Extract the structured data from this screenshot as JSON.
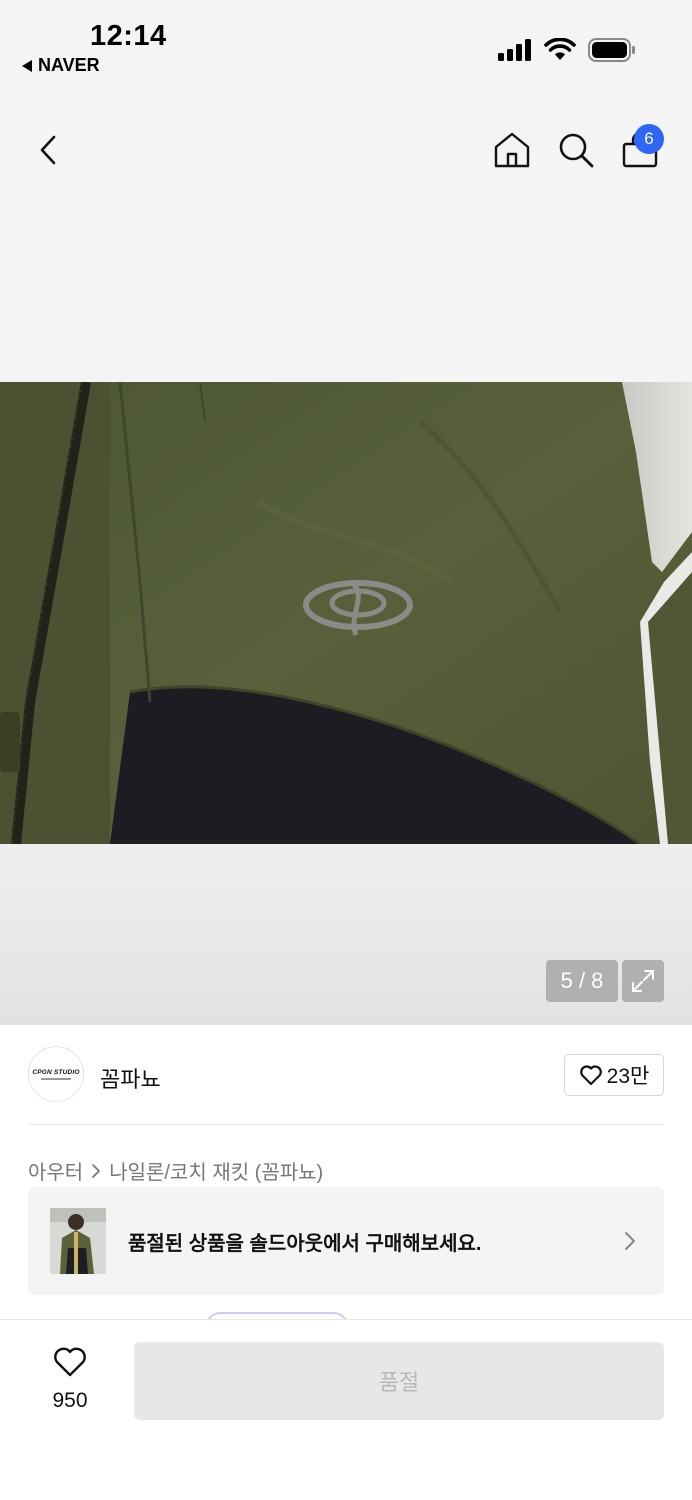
{
  "status_bar": {
    "time": "12:14",
    "back_app": "NAVER"
  },
  "nav": {
    "cart_count": "6"
  },
  "gallery": {
    "page_indicator": "5 / 8"
  },
  "seller": {
    "logo_text": "CPGN STUDIO",
    "name": "꼼파뇨",
    "like_count": "23만"
  },
  "breadcrumb": {
    "category": "아우터",
    "subcategory": "나일론/코치 재킷 (꼼파뇨)"
  },
  "banner": {
    "text": "품절된 상품을 솔드아웃에서 구매해보세요."
  },
  "bottom": {
    "wish_count": "950",
    "action_label": "품절"
  },
  "colors": {
    "accent_badge": "#2f66f6",
    "jacket_olive": "#525a37",
    "disabled_button": "#e7e7e7"
  }
}
